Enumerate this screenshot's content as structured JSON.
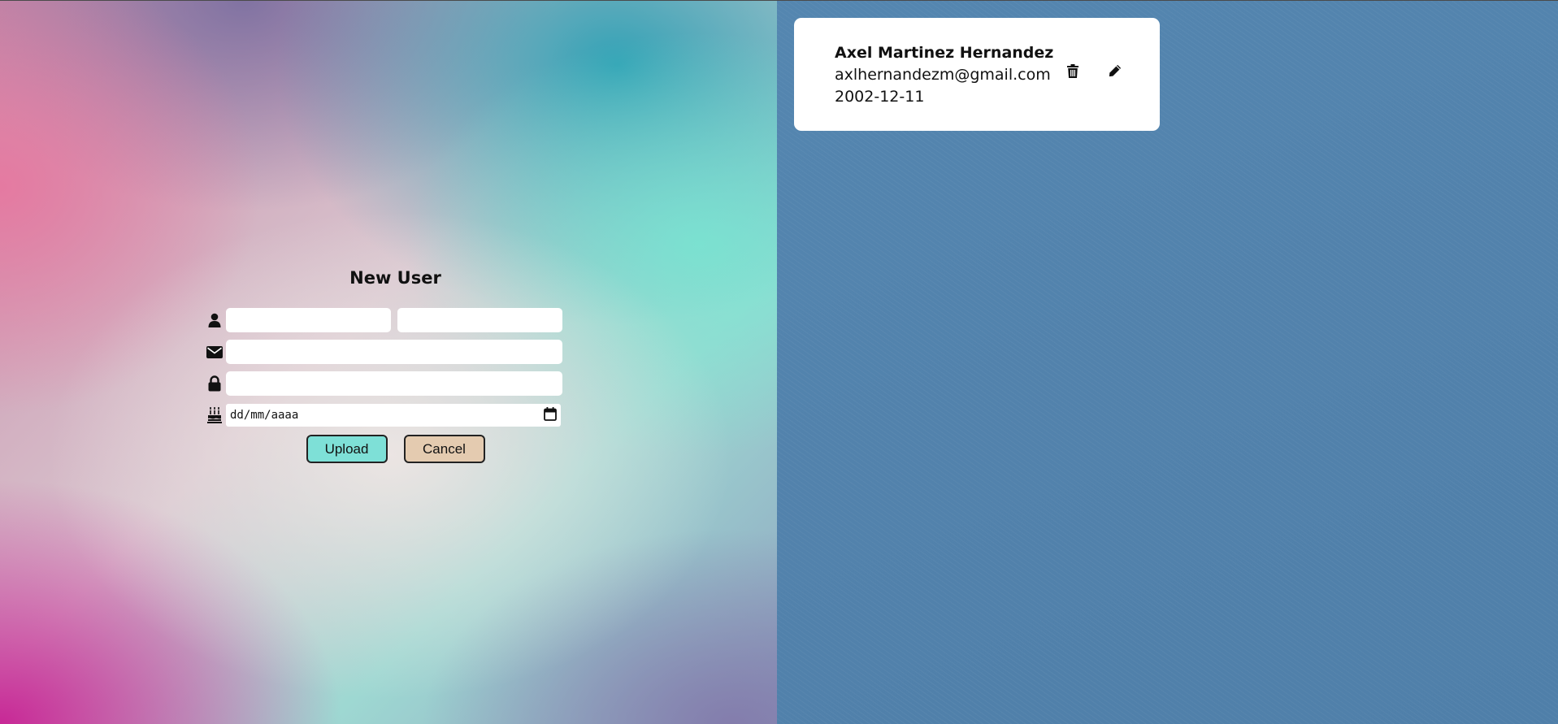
{
  "form": {
    "title": "New User",
    "first_name": {
      "value": "",
      "placeholder": ""
    },
    "last_name": {
      "value": "",
      "placeholder": ""
    },
    "email": {
      "value": "",
      "placeholder": ""
    },
    "password": {
      "value": "",
      "placeholder": ""
    },
    "birthdate": {
      "placeholder_text": "dd/mm/aaaa"
    },
    "icons": {
      "name": "user-icon",
      "email": "envelope-icon",
      "password": "lock-icon",
      "birthdate": "birthday-cake-icon",
      "calendar": "calendar-icon"
    },
    "upload_label": "Upload",
    "cancel_label": "Cancel"
  },
  "users": [
    {
      "name": "Axel Martinez Hernandez",
      "email": "axlhernandezm@gmail.com",
      "birthdate": "2002-12-11",
      "actions": {
        "delete_icon": "trash-icon",
        "edit_icon": "pencil-icon"
      }
    }
  ],
  "colors": {
    "upload_button": "#7ee0d7",
    "cancel_button": "#e4cbb0",
    "right_panel": "#5282ac",
    "card": "#ffffff"
  }
}
